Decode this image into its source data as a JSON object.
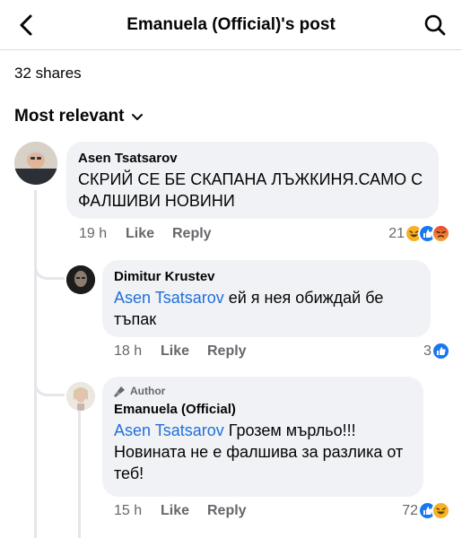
{
  "header": {
    "title": "Emanuela (Official)'s post"
  },
  "post_stats": {
    "shares": "32 shares"
  },
  "sort": {
    "label": "Most relevant"
  },
  "comments": [
    {
      "author": "Asen Tsatsarov",
      "text": "СКРИЙ СЕ БЕ СКАПАНА ЛЪЖКИНЯ.САМО С ФАЛШИВИ НОВИНИ",
      "time": "19 h",
      "like": "Like",
      "reply": "Reply",
      "reaction_count": "21",
      "reactions": [
        "haha",
        "like",
        "angry"
      ]
    },
    {
      "author": "Dimitur Krustev",
      "mention": "Asen Tsatsarov",
      "text": " ей я нея обиждай бе тъпак",
      "time": "18 h",
      "like": "Like",
      "reply": "Reply",
      "reaction_count": "3",
      "reactions": [
        "like"
      ]
    },
    {
      "badge": "Author",
      "author": "Emanuela (Official)",
      "mention": "Asen Tsatsarov",
      "text": " Грозем мърльо!!! Новината не е фалшива за разлика от теб!",
      "time": "15 h",
      "like": "Like",
      "reply": "Reply",
      "reaction_count": "72",
      "reactions": [
        "like",
        "haha"
      ]
    }
  ],
  "colors": {
    "mention": "#216fdb",
    "bubble": "#f0f2f5",
    "muted": "#65676b",
    "like_blue": "#1877f2",
    "haha_yellow": "#f7b125",
    "angry_red": "#e9710f"
  }
}
